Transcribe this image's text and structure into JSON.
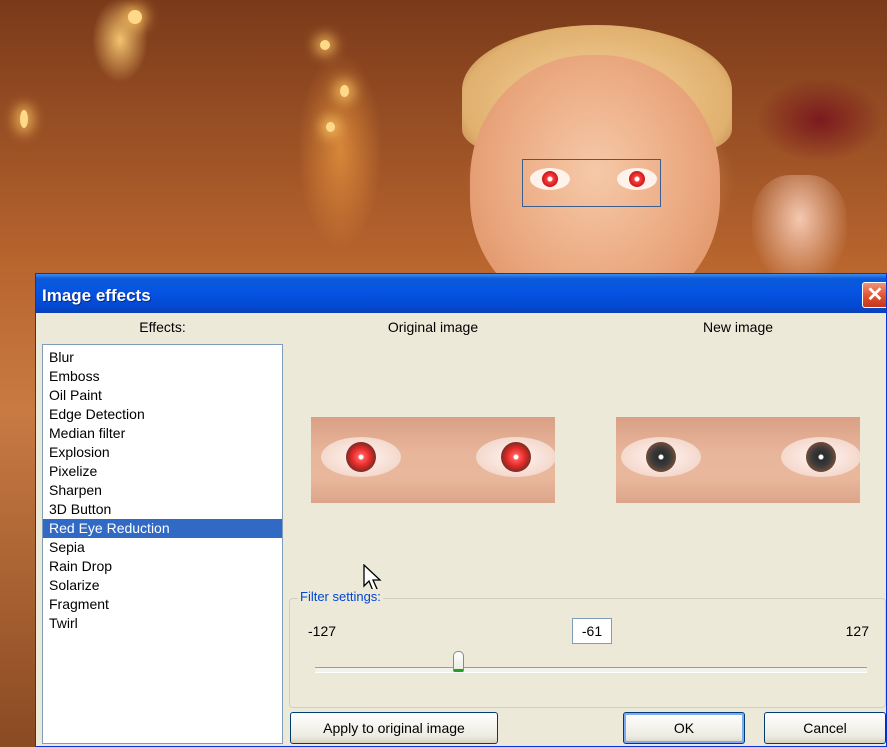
{
  "window": {
    "title": "Image effects",
    "close_glyph": "✕"
  },
  "effects_header": "Effects:",
  "original_header": "Original image",
  "new_header": "New image",
  "effects": [
    "Blur",
    "Emboss",
    "Oil Paint",
    "Edge Detection",
    "Median filter",
    "Explosion",
    "Pixelize",
    "Sharpen",
    "3D Button",
    "Red Eye Reduction",
    "Sepia",
    "Rain Drop",
    "Solarize",
    "Fragment",
    "Twirl"
  ],
  "selected_effect": "Red Eye Reduction",
  "filter": {
    "legend": "Filter settings:",
    "min_label": "-127",
    "max_label": "127",
    "value_label": "-61",
    "min": -127,
    "max": 127,
    "value": -61
  },
  "buttons": {
    "apply": "Apply to original image",
    "ok": "OK",
    "cancel": "Cancel"
  },
  "colors": {
    "titlebar": "#0554e3",
    "selection": "#316ac5",
    "dialog_bg": "#ece9d8",
    "legend": "#0046d5"
  },
  "icons": [
    "close-icon",
    "mouse-cursor-icon"
  ]
}
